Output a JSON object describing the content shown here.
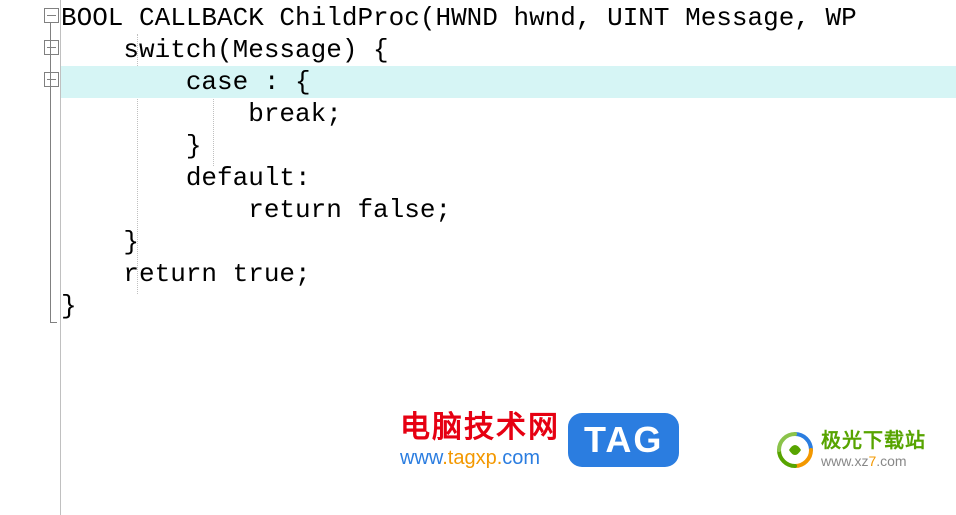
{
  "code": {
    "l1": "BOOL CALLBACK ChildProc(HWND hwnd, UINT Message, WP",
    "l2": "    switch(Message) {",
    "l3": "        case : {",
    "l4": "            break;",
    "l5": "        }",
    "l6": "        default:",
    "l7": "            return false;",
    "l8": "    }",
    "l9": "    return true;",
    "l10": "}"
  },
  "watermark1": {
    "title": "电脑技术网",
    "url_prefix": "www",
    "url_mid": ".tagxp.",
    "url_suffix": "com",
    "tag": "TAG"
  },
  "watermark2": {
    "title": "极光下载站",
    "url_pre": "www.xz",
    "url_seven": "7",
    "url_post": ".com"
  }
}
